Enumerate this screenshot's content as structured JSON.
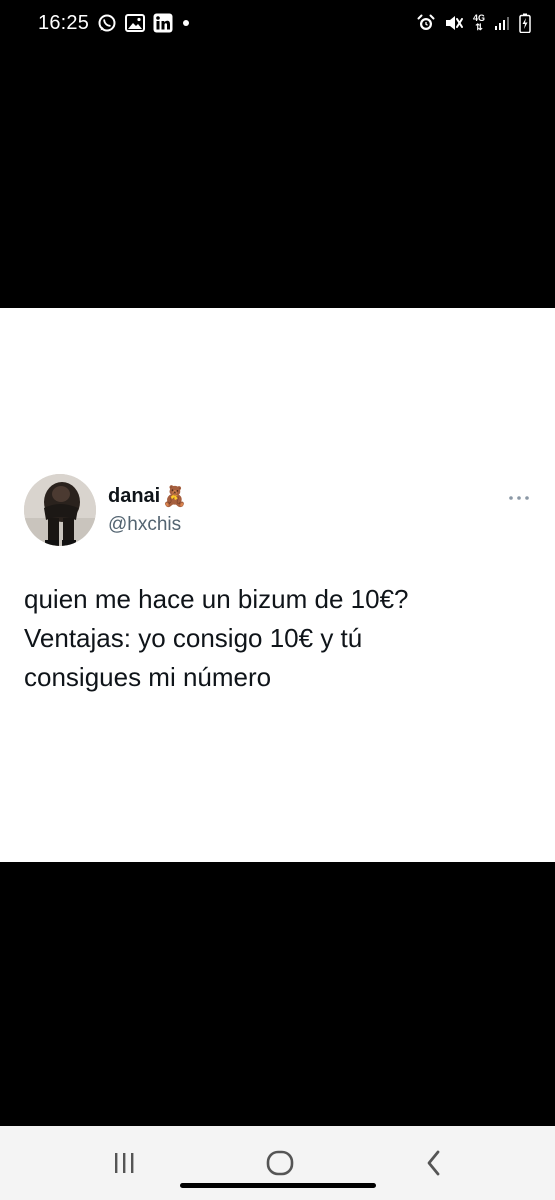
{
  "status_bar": {
    "time": "16:25",
    "network_type": "4G",
    "left_icons": [
      "whatsapp-icon",
      "gallery-icon",
      "linkedin-icon",
      "notification-dot-icon"
    ],
    "right_icons": [
      "alarm-icon",
      "mute-icon",
      "4g-data-icon",
      "signal-icon",
      "battery-icon"
    ]
  },
  "tweet": {
    "display_name": "danai",
    "name_emoji": "🧸",
    "handle": "@hxchis",
    "more_icon": "more-dots-icon",
    "text_lines": [
      "quien me hace un bizum de 10€?",
      "Ventajas: yo consigo 10€ y tú",
      "consigues mi número"
    ]
  },
  "nav_bar": {
    "icons": [
      "recent-apps-icon",
      "home-icon",
      "back-icon"
    ]
  },
  "colors": {
    "background": "#000000",
    "card": "#ffffff",
    "text_primary": "#0f1419",
    "text_secondary": "#536471",
    "nav_bar": "#f4f4f4"
  }
}
